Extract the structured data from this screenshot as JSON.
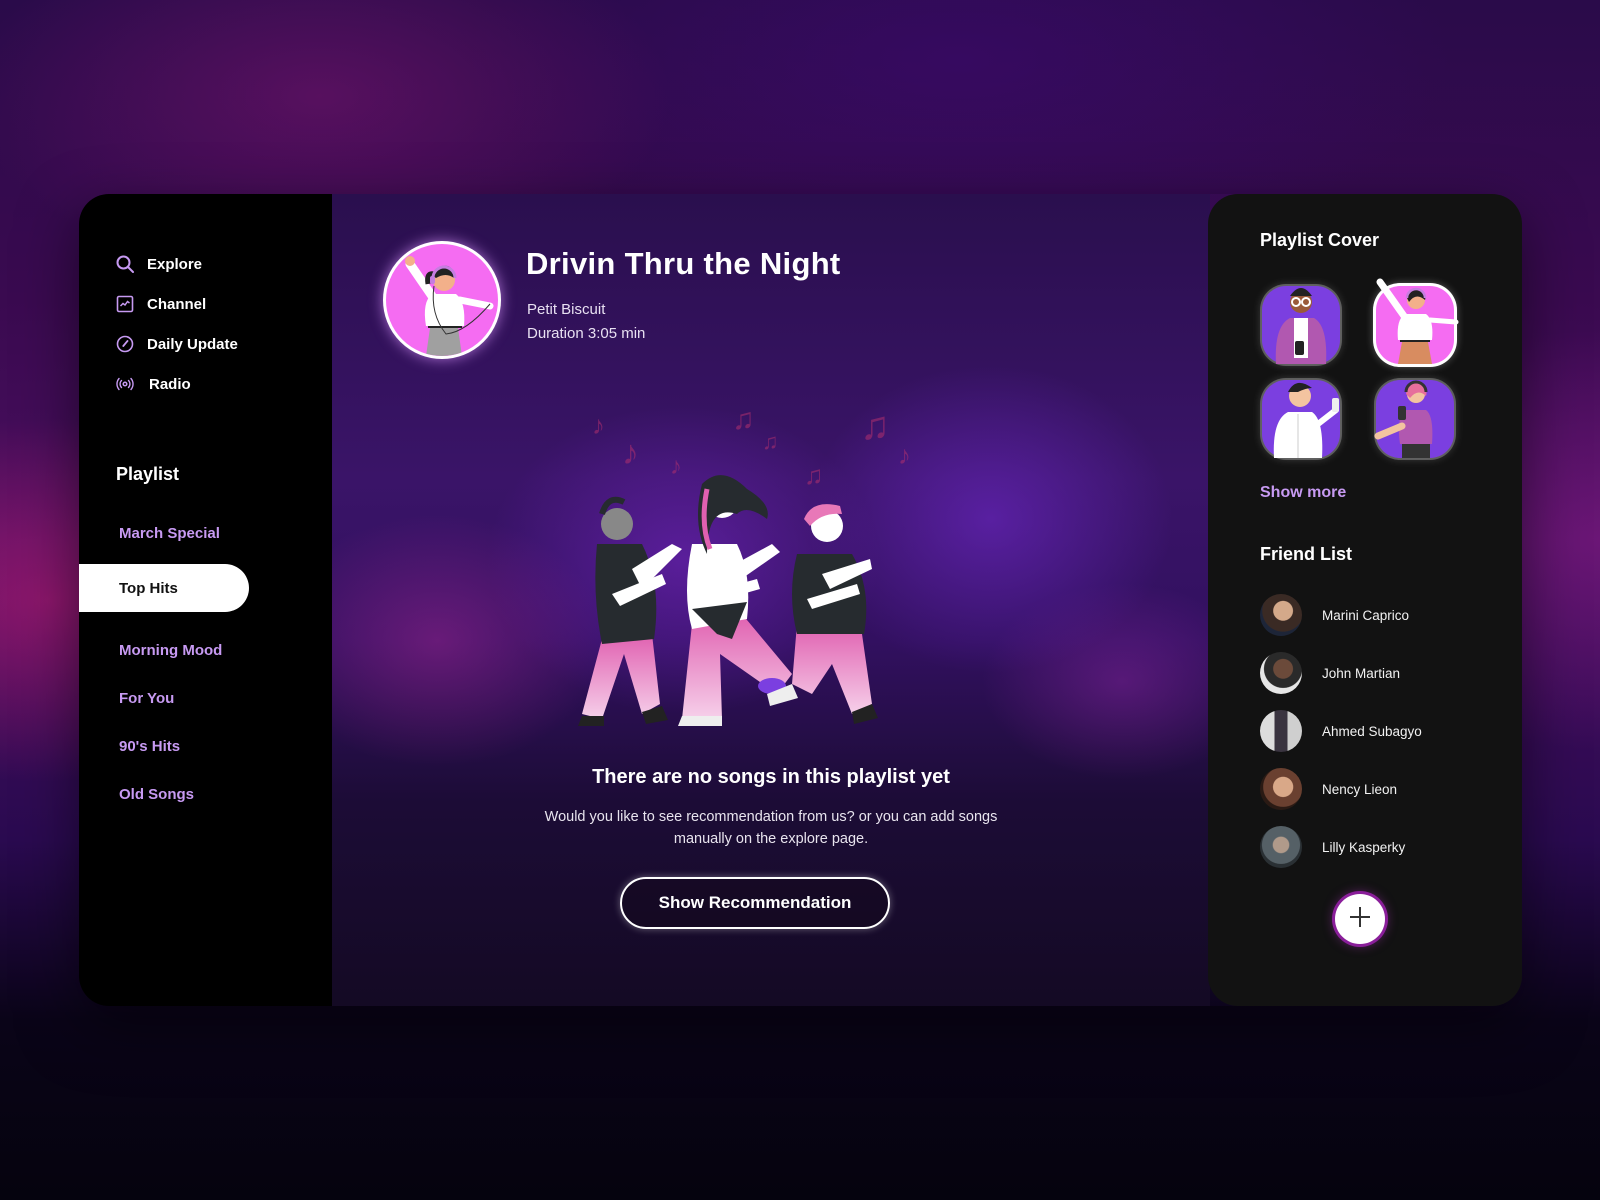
{
  "nav": {
    "items": [
      {
        "label": "Explore",
        "icon": "search-icon"
      },
      {
        "label": "Channel",
        "icon": "activity-chart-icon"
      },
      {
        "label": "Daily Update",
        "icon": "gauge-icon"
      },
      {
        "label": "Radio",
        "icon": "broadcast-icon"
      }
    ]
  },
  "playlist": {
    "title": "Playlist",
    "items": [
      {
        "label": "March Special",
        "active": false
      },
      {
        "label": "Top Hits",
        "active": true
      },
      {
        "label": "Morning Mood",
        "active": false
      },
      {
        "label": "For You",
        "active": false
      },
      {
        "label": "90's Hits",
        "active": false
      },
      {
        "label": "Old Songs",
        "active": false
      }
    ]
  },
  "song": {
    "title": "Drivin Thru the Night",
    "artist": "Petit Biscuit",
    "duration": "Duration 3:05 min"
  },
  "empty_state": {
    "title": "There are no songs in this playlist yet",
    "description": "Would you like to see recommendation from us? or you can add songs manually on the explore page.",
    "button_label": "Show Recommendation"
  },
  "right_panel": {
    "cover_title": "Playlist Cover",
    "covers": [
      {
        "name": "man-with-glasses",
        "color": "#7b3fe0",
        "selected": false
      },
      {
        "name": "woman-waving-headphones",
        "color": "#f56cf2",
        "selected": true
      },
      {
        "name": "man-with-phone",
        "color": "#7b3fe0",
        "selected": false
      },
      {
        "name": "woman-pink-hair-headphones",
        "color": "#7b3fe0",
        "selected": false
      }
    ],
    "show_more": "Show more",
    "friends_title": "Friend List",
    "friends": [
      {
        "name": "Marini Caprico"
      },
      {
        "name": "John Martian"
      },
      {
        "name": "Ahmed Subagyo"
      },
      {
        "name": "Nency Lieon"
      },
      {
        "name": "Lilly Kasperky"
      }
    ],
    "add_button_icon": "plus-icon"
  },
  "colors": {
    "accent": "#c79af2",
    "cover_pink": "#f56cf2",
    "cover_purple": "#7b3fe0",
    "sidebar_bg": "#000000",
    "panel_bg": "#121212"
  }
}
